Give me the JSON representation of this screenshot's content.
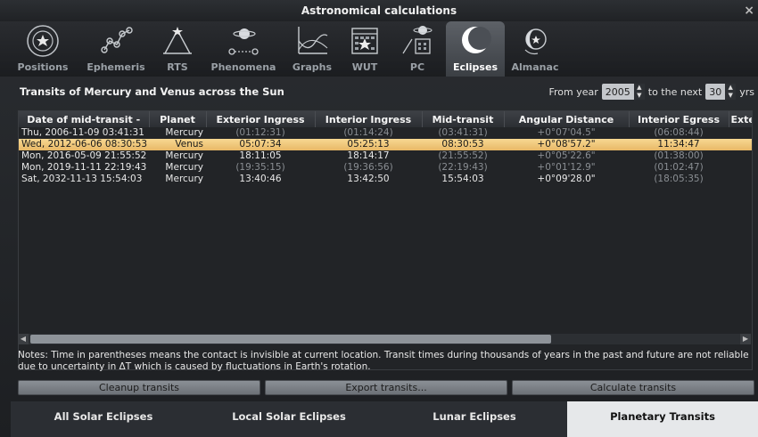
{
  "window": {
    "title": "Astronomical calculations",
    "close_glyph": "×"
  },
  "toolbar": {
    "tabs": [
      {
        "label": "Positions",
        "icon": "positions-icon"
      },
      {
        "label": "Ephemeris",
        "icon": "ephemeris-icon"
      },
      {
        "label": "RTS",
        "icon": "rts-icon"
      },
      {
        "label": "Phenomena",
        "icon": "phenomena-icon"
      },
      {
        "label": "Graphs",
        "icon": "graphs-icon"
      },
      {
        "label": "WUT",
        "icon": "wut-icon"
      },
      {
        "label": "PC",
        "icon": "pc-icon"
      },
      {
        "label": "Eclipses",
        "icon": "eclipses-icon",
        "active": true
      },
      {
        "label": "Almanac",
        "icon": "almanac-icon"
      }
    ]
  },
  "section": {
    "title": "Transits of Mercury and Venus across the Sun",
    "from_year_label": "From year",
    "from_year_value": "2005",
    "next_label": "to the next",
    "next_value": "30",
    "yrs_label": "yrs"
  },
  "table": {
    "columns": [
      "Date of mid-transit",
      "Planet",
      "Exterior Ingress",
      "Interior Ingress",
      "Mid-transit",
      "Angular Distance",
      "Interior Egress",
      "Exte"
    ],
    "sort_indicator": "-",
    "rows": [
      {
        "date": "Thu, 2006-11-09 03:41:31",
        "planet": "Mercury",
        "ext_ingress": "(01:12:31)",
        "int_ingress": "(01:14:24)",
        "mid": "(03:41:31)",
        "ang": "+0°07'04.5\"",
        "int_egress": "(06:08:44)",
        "dim": [
          true,
          true,
          true,
          true,
          true
        ],
        "selected": false
      },
      {
        "date": "Wed, 2012-06-06 08:30:53",
        "planet": "Venus",
        "ext_ingress": "05:07:34",
        "int_ingress": "05:25:13",
        "mid": "08:30:53",
        "ang": "+0°08'57.2\"",
        "int_egress": "11:34:47",
        "dim": [
          false,
          false,
          false,
          false,
          false
        ],
        "selected": true
      },
      {
        "date": "Mon, 2016-05-09 21:55:52",
        "planet": "Mercury",
        "ext_ingress": "18:11:05",
        "int_ingress": "18:14:17",
        "mid": "(21:55:52)",
        "ang": "+0°05'22.6\"",
        "int_egress": "(01:38:00)",
        "dim": [
          false,
          false,
          true,
          true,
          true
        ],
        "selected": false
      },
      {
        "date": "Mon, 2019-11-11 22:19:43",
        "planet": "Mercury",
        "ext_ingress": "(19:35:15)",
        "int_ingress": "(19:36:56)",
        "mid": "(22:19:43)",
        "ang": "+0°01'12.9\"",
        "int_egress": "(01:02:47)",
        "dim": [
          true,
          true,
          true,
          true,
          true
        ],
        "selected": false
      },
      {
        "date": "Sat, 2032-11-13 15:54:03",
        "planet": "Mercury",
        "ext_ingress": "13:40:46",
        "int_ingress": "13:42:50",
        "mid": "15:54:03",
        "ang": "+0°09'28.0\"",
        "int_egress": "(18:05:35)",
        "dim": [
          false,
          false,
          false,
          false,
          true
        ],
        "selected": false
      }
    ]
  },
  "notes": "Notes: Time in parentheses means the contact is invisible at current location. Transit times during thousands of years in the past and future are not reliable due to uncertainty in ΔT which is caused by fluctuations in Earth's rotation.",
  "buttons": {
    "cleanup": "Cleanup transits",
    "export": "Export transits...",
    "calculate": "Calculate transits"
  },
  "bottom_tabs": [
    {
      "label": "All Solar Eclipses"
    },
    {
      "label": "Local Solar Eclipses"
    },
    {
      "label": "Lunar Eclipses"
    },
    {
      "label": "Planetary Transits",
      "active": true
    }
  ],
  "colors": {
    "selection": "#f0c878",
    "dim_text": "#8a8e93",
    "active_tab": "#5d6167"
  }
}
